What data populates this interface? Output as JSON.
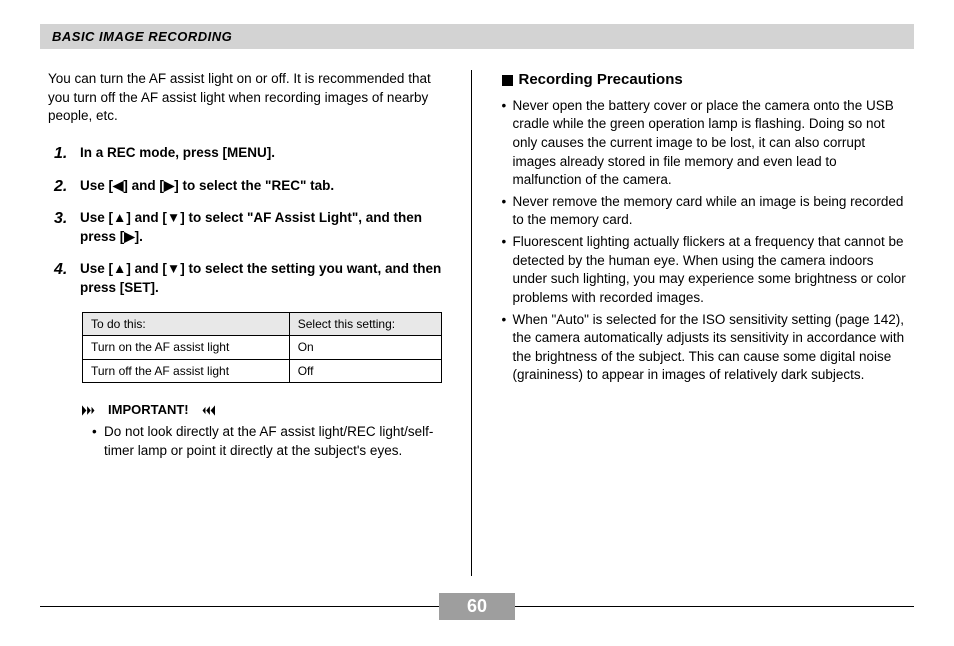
{
  "header": {
    "title": "BASIC IMAGE RECORDING"
  },
  "left": {
    "intro": "You can turn the AF assist light on or off. It is recommended that you turn off the AF assist light when recording images of nearby people, etc.",
    "steps": [
      "In a REC mode, press [MENU].",
      "Use [◀] and [▶] to select the \"REC\" tab.",
      "Use [▲] and [▼] to select \"AF Assist Light\", and then press [▶].",
      "Use [▲] and [▼] to select the setting you want, and then press [SET]."
    ],
    "table": {
      "head": [
        "To do this:",
        "Select this setting:"
      ],
      "rows": [
        [
          "Turn on the AF assist light",
          "On"
        ],
        [
          "Turn off the AF assist light",
          "Off"
        ]
      ]
    },
    "important_label": "IMPORTANT!",
    "important_items": [
      "Do not look directly at the AF assist light/REC light/self-timer lamp or point it directly at the subject's eyes."
    ]
  },
  "right": {
    "subhead": "Recording Precautions",
    "items": [
      "Never open the battery cover or place the camera onto the USB cradle while the green operation lamp is flashing. Doing so not only causes the current image to be lost, it can also corrupt images already stored in file memory and even lead to malfunction of the camera.",
      "Never remove the memory card while an image is being recorded to the memory card.",
      "Fluorescent lighting actually flickers at a frequency that cannot be detected by the human eye. When using the camera indoors under such lighting, you may experience some brightness or color problems with recorded images.",
      "When \"Auto\" is selected for the ISO sensitivity setting (page 142), the camera automatically adjusts its sensitivity in accordance with the brightness of the subject. This can cause some digital noise (graininess) to appear in images of relatively dark subjects."
    ]
  },
  "footer": {
    "page": "60"
  }
}
